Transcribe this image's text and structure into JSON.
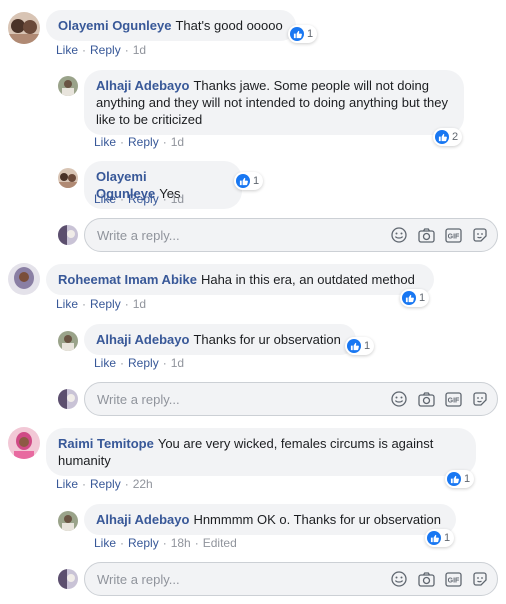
{
  "comments": [
    {
      "author": "Olayemi Ogunleye",
      "text": "That's good ooooo",
      "like": "Like",
      "reply": "Reply",
      "time": "1d",
      "reactions": "1",
      "avatar_colors": [
        "#8a6e5a",
        "#d9c3b0"
      ],
      "replies": [
        {
          "author": "Alhaji Adebayo",
          "text": "Thanks jawe. Some people will not doing anything and they will not intended to doing anything but they like to be criticized",
          "like": "Like",
          "reply": "Reply",
          "time": "1d",
          "reactions": "2"
        },
        {
          "author": "Olayemi Ogunleye",
          "text": "Yes",
          "like": "Like",
          "reply": "Reply",
          "time": "1d",
          "reactions": "1"
        }
      ]
    },
    {
      "author": "Roheemat Imam Abike",
      "text": "Haha in this era, an outdated method",
      "like": "Like",
      "reply": "Reply",
      "time": "1d",
      "reactions": "1",
      "replies": [
        {
          "author": "Alhaji Adebayo",
          "text": "Thanks for ur observation",
          "like": "Like",
          "reply": "Reply",
          "time": "1d",
          "reactions": "1"
        }
      ]
    },
    {
      "author": "Raimi Temitope",
      "text": "You are very wicked, females circums is against humanity",
      "like": "Like",
      "reply": "Reply",
      "time": "22h",
      "reactions": "1",
      "replies": [
        {
          "author": "Alhaji Adebayo",
          "text": "Hnmmmm OK o. Thanks for ur observation",
          "like": "Like",
          "reply": "Reply",
          "time": "18h",
          "edited": "Edited",
          "reactions": "1"
        }
      ]
    }
  ],
  "reply_box": {
    "placeholder": "Write a reply..."
  },
  "colors": {
    "link": "#385898",
    "meta": "#90949c",
    "bubble": "#f2f3f5",
    "like_blue": "#1877f2"
  }
}
